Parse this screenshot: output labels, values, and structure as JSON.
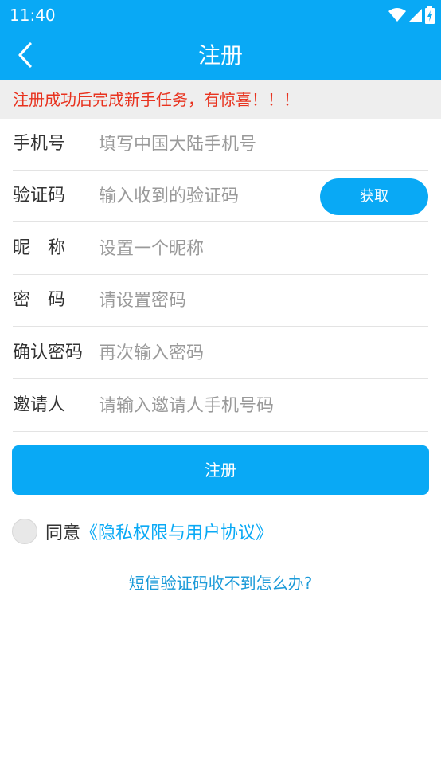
{
  "status_bar": {
    "time": "11:40"
  },
  "app_bar": {
    "title": "注册"
  },
  "notice": "注册成功后完成新手任务，有惊喜！！！",
  "form": {
    "phone": {
      "label": "手机号",
      "placeholder": "填写中国大陆手机号"
    },
    "code": {
      "label": "验证码",
      "placeholder": "输入收到的验证码",
      "button": "获取"
    },
    "nickname": {
      "label": "昵　称",
      "placeholder": "设置一个昵称"
    },
    "password": {
      "label": "密　码",
      "placeholder": "请设置密码"
    },
    "confirm": {
      "label": "确认密码",
      "placeholder": "再次输入密码"
    },
    "inviter": {
      "label": "邀请人",
      "placeholder": "请输入邀请人手机号码"
    }
  },
  "submit_label": "注册",
  "agreement": {
    "prefix": "同意",
    "link": "《隐私权限与用户协议》"
  },
  "help_link": "短信验证码收不到怎么办?",
  "colors": {
    "primary": "#09a9f5",
    "notice_text": "#e8321e",
    "notice_bg": "#eeeeee"
  },
  "icons": {
    "status": [
      "wifi-icon",
      "signal-icon",
      "battery-charging-icon"
    ],
    "back": "chevron-left-icon"
  }
}
